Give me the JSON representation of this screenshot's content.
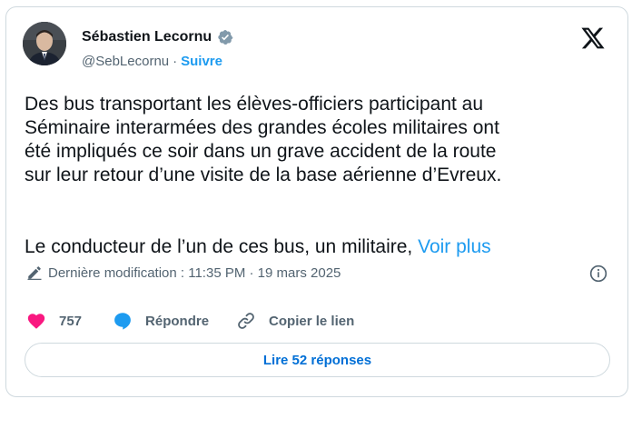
{
  "author": {
    "name": "Sébastien Lecornu",
    "handle": "@SebLecornu",
    "separator": "·",
    "follow_label": "Suivre"
  },
  "tweet": {
    "text": "Des bus transportant les élèves-officiers participant au\nSéminaire interarmées des grandes écoles militaires ont\nété impliqués ce soir dans un grave accident de la route\nsur leur retour d’une visite de la base aérienne d’Evreux.",
    "text2": "Le conducteur de l’un de ces bus, un militaire,",
    "see_more_label": "Voir plus"
  },
  "edit_info": "Dernière modification : 11:35 PM · 19 mars 2025",
  "actions": {
    "likes": "757",
    "reply_label": "Répondre",
    "copy_label": "Copier le lien"
  },
  "replies_button": "Lire 52 réponses",
  "colors": {
    "accent": "#1d9bf0",
    "like": "#f91880",
    "text_secondary": "#536471",
    "border": "#cfd9de"
  },
  "icons": [
    "verified-badge-icon",
    "x-logo-icon",
    "pencil-icon",
    "info-icon",
    "heart-icon",
    "speech-bubble-icon",
    "link-icon"
  ]
}
